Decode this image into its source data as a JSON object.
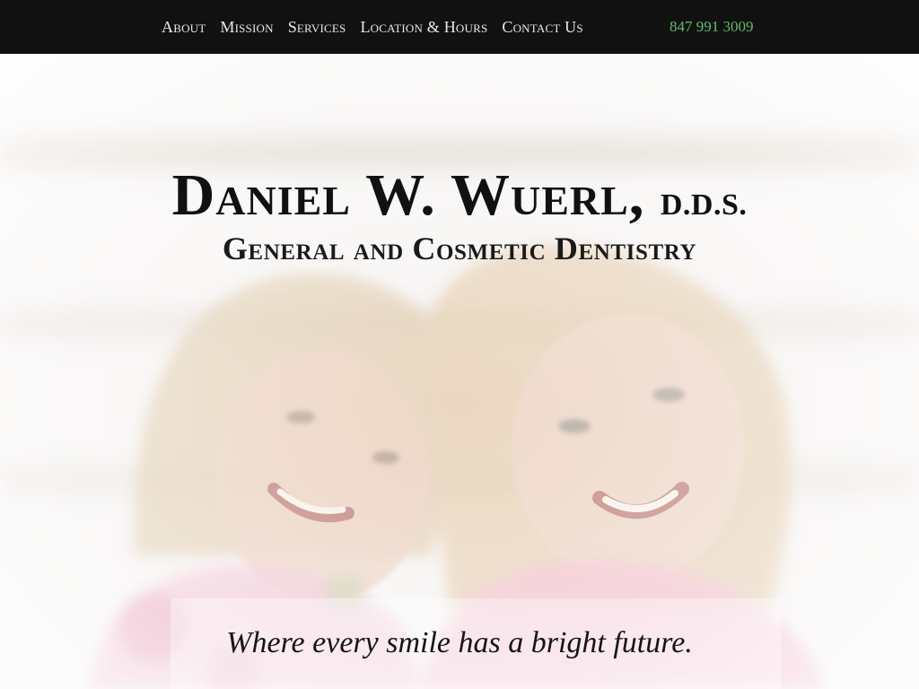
{
  "nav": {
    "items": [
      {
        "label": "About"
      },
      {
        "label": "Mission"
      },
      {
        "label": "Services"
      },
      {
        "label": "Location & Hours"
      },
      {
        "label": "Contact Us"
      }
    ],
    "phone": "847 991 3009"
  },
  "hero": {
    "title": "Daniel W. Wuerl,",
    "title_suffix": "D.D.S.",
    "subtitle": "General and Cosmetic Dentistry",
    "tagline": "Where every smile has a bright future.",
    "image_subject": "two smiling girls"
  },
  "colors": {
    "nav_background": "#111111",
    "nav_text": "#e9e9e9",
    "phone_text": "#64b96d",
    "heading_text": "#111111"
  }
}
